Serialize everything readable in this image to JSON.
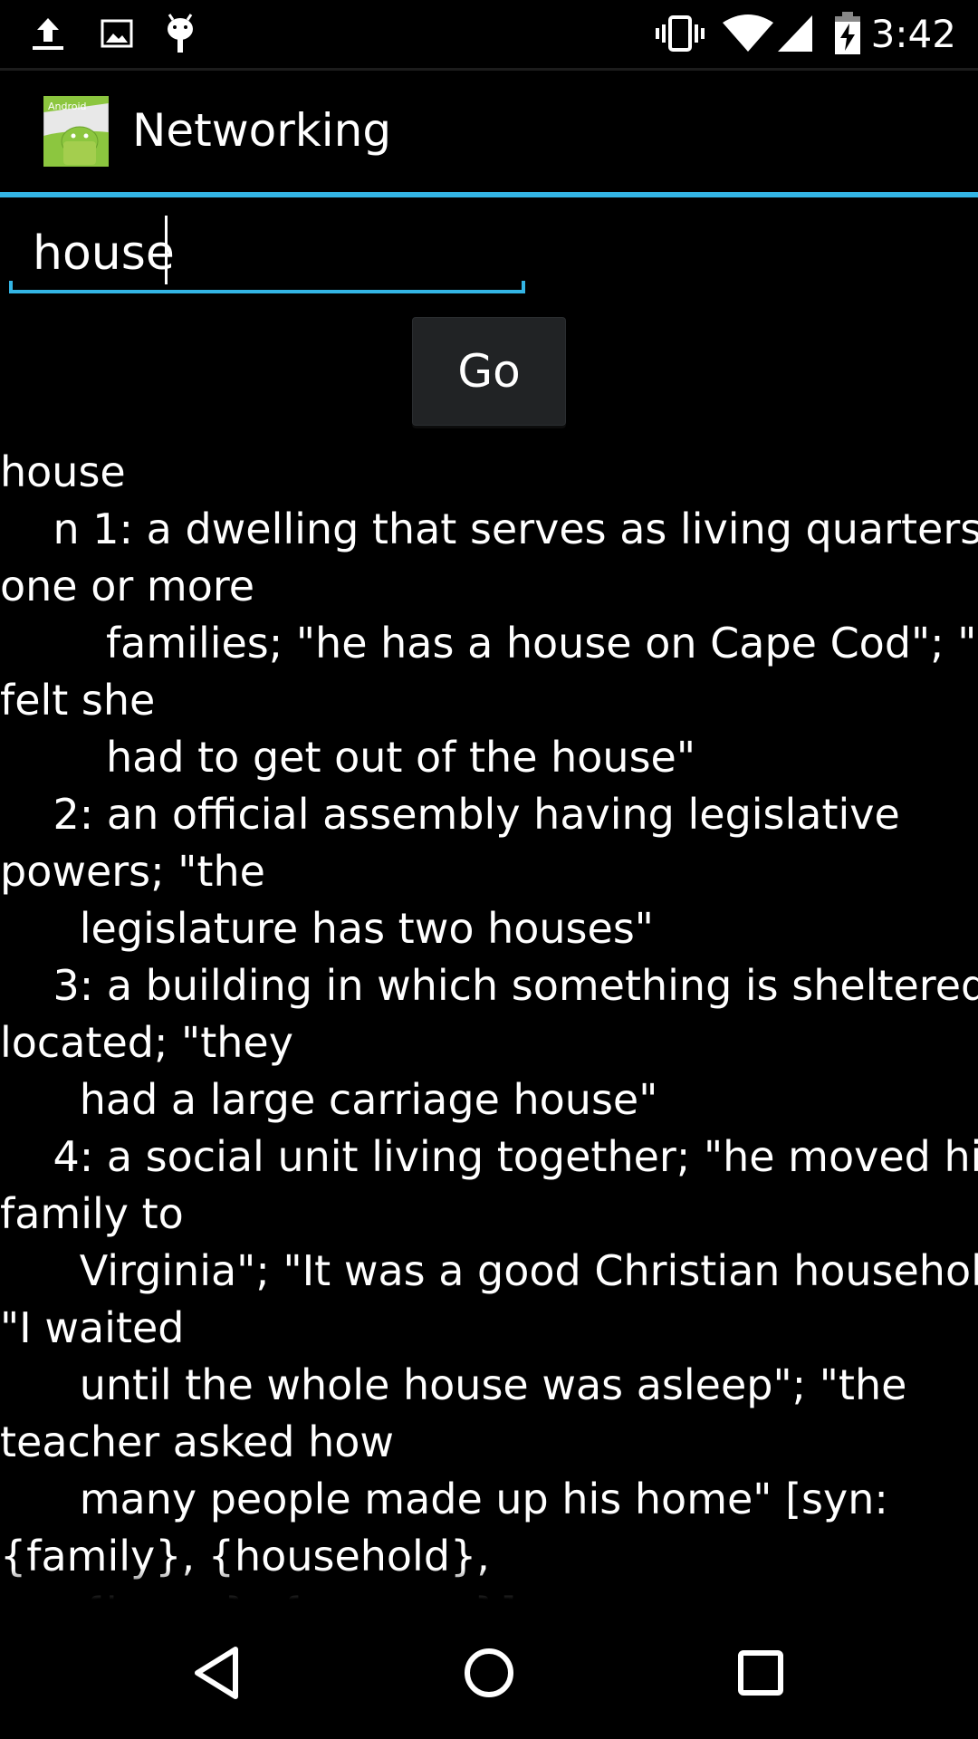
{
  "status_bar": {
    "time": "3:42",
    "icons": [
      "upload-icon",
      "image-icon",
      "android-debug-icon",
      "vibrate-icon",
      "wifi-icon",
      "signal-icon",
      "battery-charging-icon"
    ]
  },
  "action_bar": {
    "title": "Networking",
    "app_icon_label": "Android"
  },
  "search": {
    "value": "house"
  },
  "go_button": {
    "label": "Go"
  },
  "result": {
    "text": "house\n    n 1: a dwelling that serves as living quarters for\none or more\n        families; \"he has a house on Cape Cod\"; \"she\nfelt she\n        had to get out of the house\"\n    2: an official assembly having legislative\npowers; \"the\n      legislature has two houses\"\n    3: a building in which something is sheltered or\nlocated; \"they\n      had a large carriage house\"\n    4: a social unit living together; \"he moved his\nfamily to\n      Virginia\"; \"It was a good Christian household\";\n\"I waited\n      until the whole house was asleep\"; \"the\nteacher asked how\n      many people made up his home\" [syn:\n{family}, {household},\n      {home}, {menage}]"
  },
  "nav_bar": {
    "back": "back-icon",
    "home": "home-icon",
    "recents": "recents-icon"
  },
  "colors": {
    "accent": "#33b5e5",
    "background": "#000000",
    "button": "#212325"
  }
}
